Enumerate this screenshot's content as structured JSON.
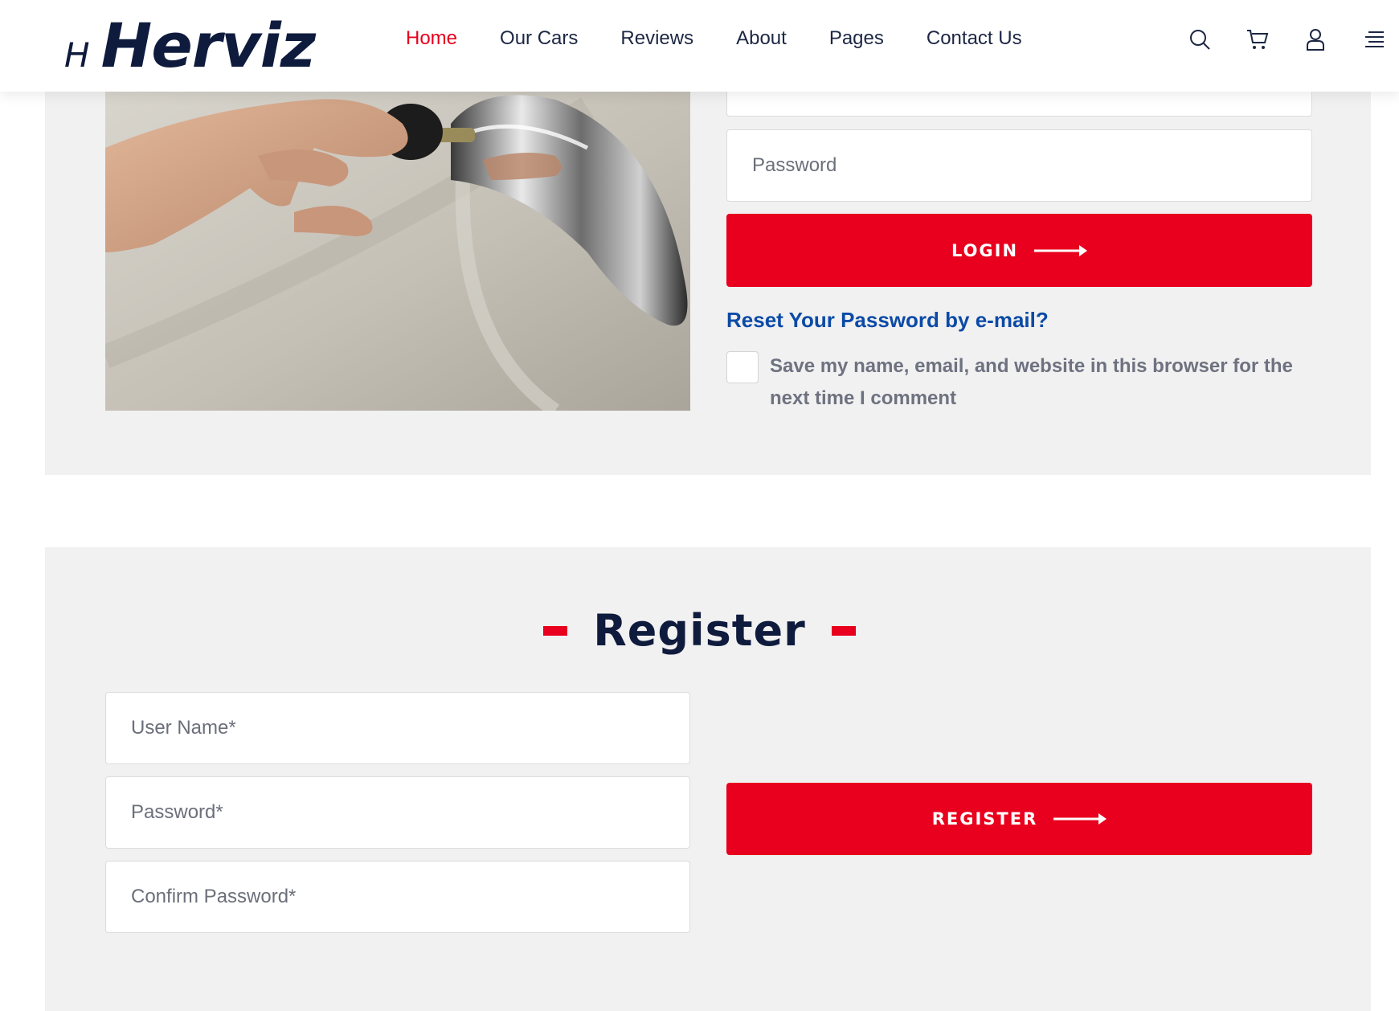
{
  "brand": {
    "mark": "H",
    "name": "Herviz"
  },
  "nav": {
    "items": [
      {
        "label": "Home",
        "active": true
      },
      {
        "label": "Our Cars",
        "active": false
      },
      {
        "label": "Reviews",
        "active": false
      },
      {
        "label": "About",
        "active": false
      },
      {
        "label": "Pages",
        "active": false
      },
      {
        "label": "Contact Us",
        "active": false
      }
    ],
    "icons": [
      "search-icon",
      "cart-icon",
      "user-icon",
      "menu-icon"
    ]
  },
  "login": {
    "username_placeholder": "",
    "password_placeholder": "Password",
    "button_label": "LOGIN",
    "reset_link": "Reset Your Password by e-mail?",
    "remember_label": "Save my name, email, and website in this browser for the next time I comment",
    "remember_checked": false
  },
  "register": {
    "title": "Register",
    "username_placeholder": "User Name*",
    "password_placeholder": "Password*",
    "confirm_placeholder": "Confirm Password*",
    "button_label": "REGISTER"
  },
  "colors": {
    "accent": "#e8001e",
    "link": "#0b4aa6",
    "navy": "#0f1b3d",
    "section_bg": "#f1f1f1"
  }
}
